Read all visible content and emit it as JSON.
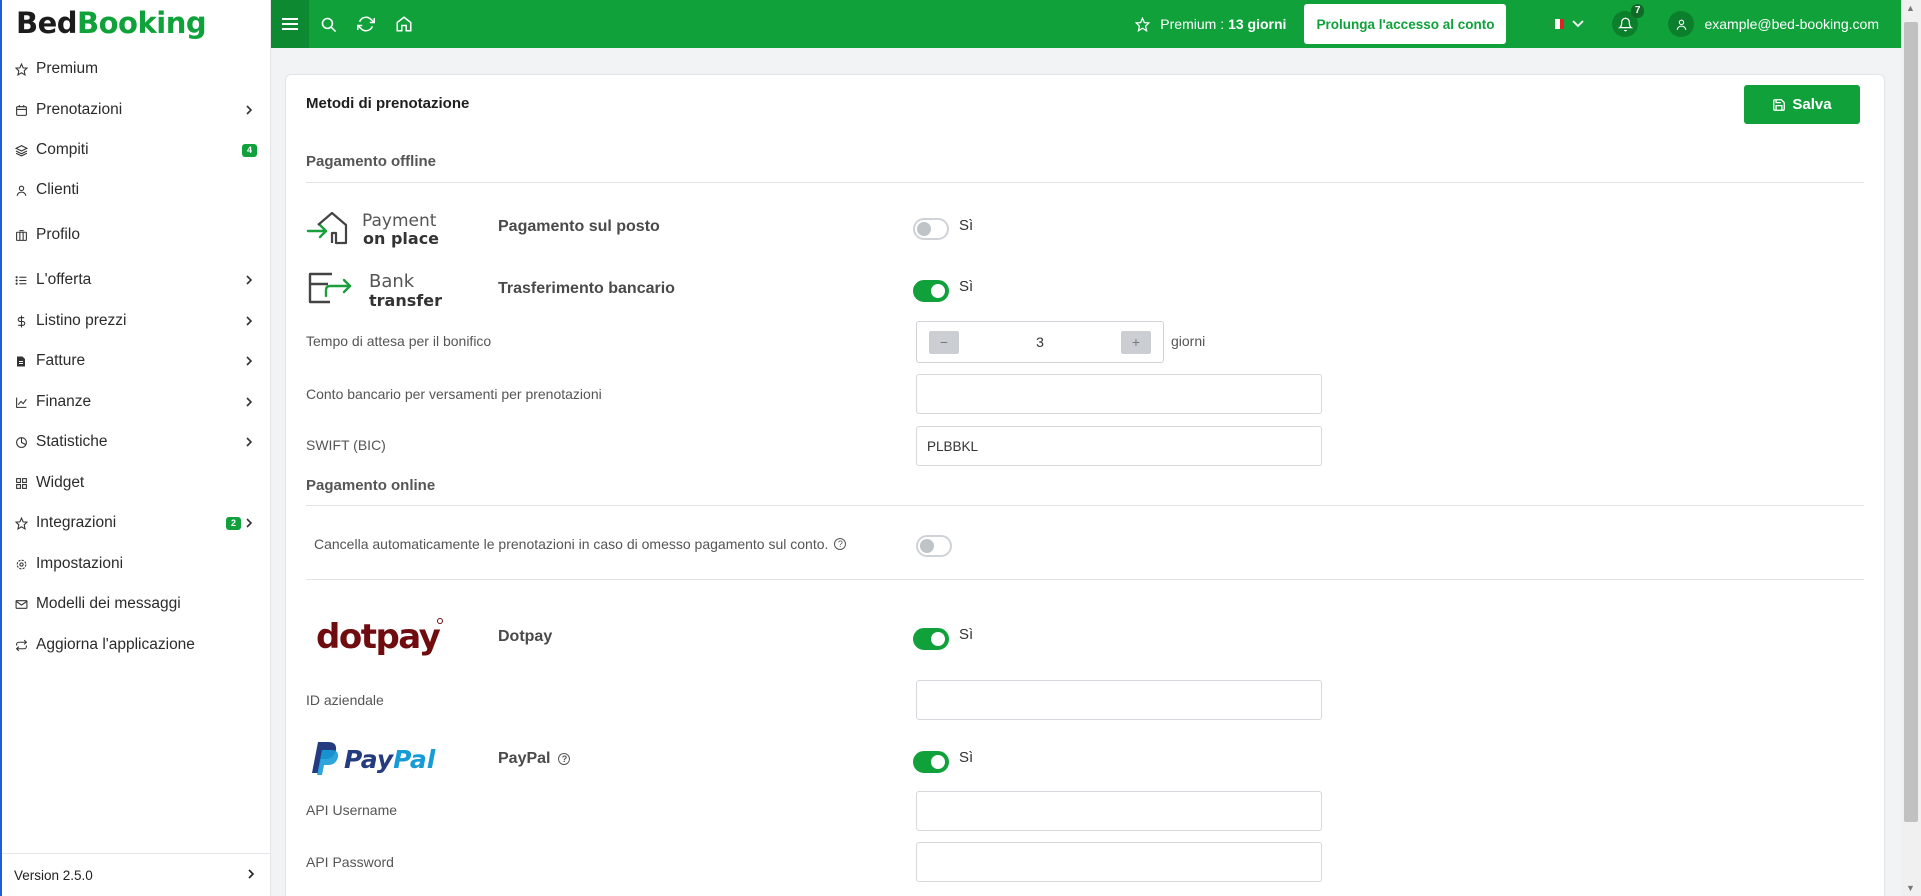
{
  "brand": {
    "part1": "Bed",
    "part2": "Booking"
  },
  "sidebar": {
    "items": [
      {
        "label": "Premium",
        "icon": "star-icon"
      },
      {
        "label": "Prenotazioni",
        "icon": "calendar-icon",
        "chevron": true
      },
      {
        "label": "Compiti",
        "icon": "layers-icon",
        "badge": "4"
      },
      {
        "label": "Clienti",
        "icon": "user-icon"
      },
      {
        "label": "Profilo",
        "icon": "building-icon"
      },
      {
        "label": "L'offerta",
        "icon": "list-icon",
        "chevron": true
      },
      {
        "label": "Listino prezzi",
        "icon": "dollar-icon",
        "chevron": true
      },
      {
        "label": "Fatture",
        "icon": "invoice-icon",
        "chevron": true
      },
      {
        "label": "Finanze",
        "icon": "chart-icon",
        "chevron": true
      },
      {
        "label": "Statistiche",
        "icon": "pie-icon",
        "chevron": true
      },
      {
        "label": "Widget",
        "icon": "grid-icon"
      },
      {
        "label": "Integrazioni",
        "icon": "star-icon",
        "badge": "2",
        "chevron": true
      },
      {
        "label": "Impostazioni",
        "icon": "gear-icon"
      },
      {
        "label": "Modelli dei messaggi",
        "icon": "mail-icon"
      },
      {
        "label": "Aggiorna l'applicazione",
        "icon": "refresh-icon"
      }
    ],
    "version": "Version 2.5.0"
  },
  "topbar": {
    "premium_label": "Premium :",
    "premium_days": "13 giorni",
    "extend_button": "Prolunga l'accesso al conto",
    "notifications_count": "7",
    "user_email": "example@bed-booking.com"
  },
  "page": {
    "title": "Metodi di prenotazione",
    "save_label": "Salva",
    "offline_section": "Pagamento offline",
    "online_section": "Pagamento online",
    "pay_on_place": {
      "logo_line1": "Payment",
      "logo_line2": "on place",
      "name": "Pagamento sul posto",
      "toggle_text": "Sì",
      "enabled": false
    },
    "bank_transfer": {
      "logo_line1": "Bank",
      "logo_line2": "transfer",
      "name": "Trasferimento bancario",
      "toggle_text": "Sì",
      "enabled": true
    },
    "wait_time": {
      "label": "Tempo di attesa per il bonifico",
      "value": "3",
      "unit": "giorni",
      "minus": "−",
      "plus": "+"
    },
    "bank_account": {
      "label": "Conto bancario per versamenti per prenotazioni",
      "value": ""
    },
    "swift": {
      "label": "SWIFT (BIC)",
      "value": "PLBBKL"
    },
    "auto_cancel": {
      "label": "Cancella automaticamente le prenotazioni in caso di omesso pagamento sul conto.",
      "enabled": false
    },
    "dotpay": {
      "logo": "dotpay",
      "name": "Dotpay",
      "toggle_text": "Sì",
      "enabled": true
    },
    "company_id": {
      "label": "ID aziendale",
      "value": ""
    },
    "paypal": {
      "logo_a": "Pay",
      "logo_b": "Pal",
      "name": "PayPal",
      "toggle_text": "Sì",
      "enabled": true
    },
    "api_username": {
      "label": "API Username",
      "value": ""
    },
    "api_password": {
      "label": "API Password",
      "value": ""
    }
  }
}
